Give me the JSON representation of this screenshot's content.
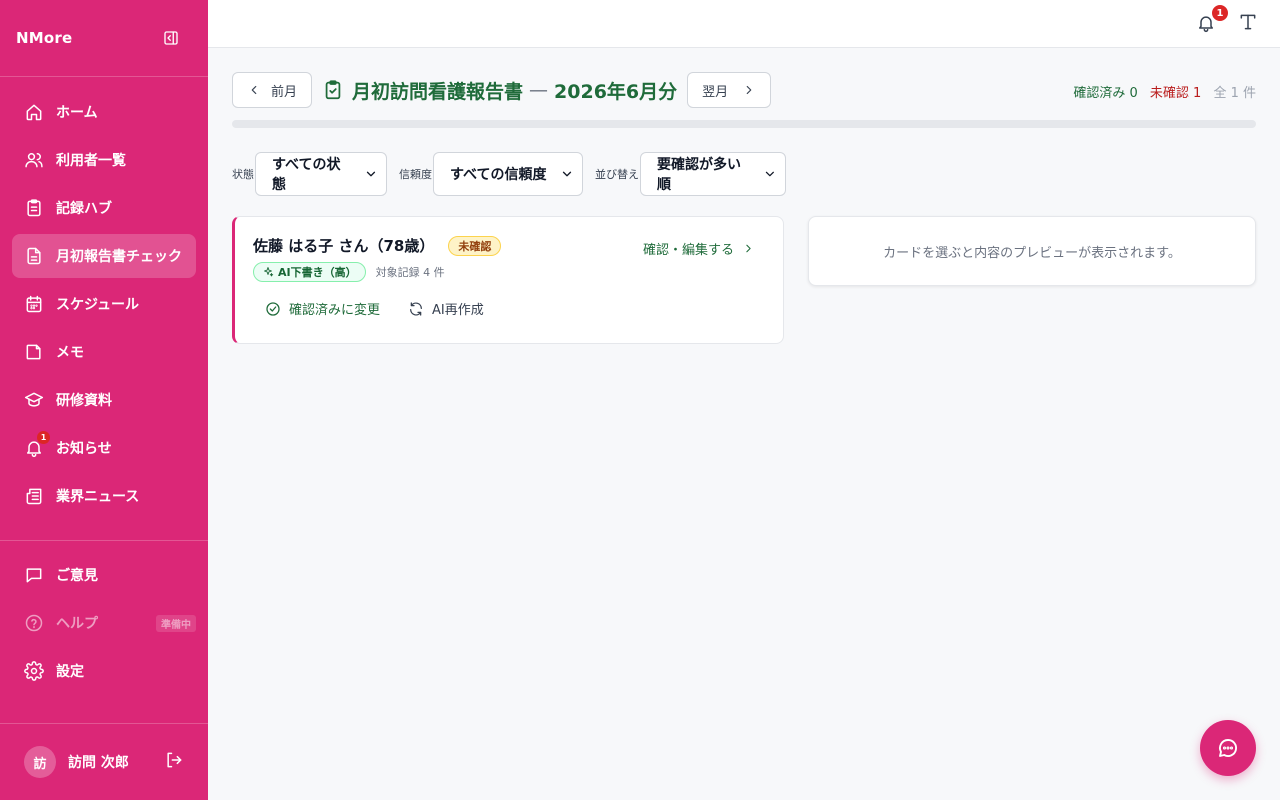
{
  "app": {
    "brand": "NMore"
  },
  "sidebar": {
    "items": [
      {
        "label": "ホーム",
        "icon": "home-icon"
      },
      {
        "label": "利用者一覧",
        "icon": "users-icon"
      },
      {
        "label": "記録ハブ",
        "icon": "clipboard-icon"
      },
      {
        "label": "月初報告書チェック",
        "icon": "document-icon",
        "active": true
      },
      {
        "label": "スケジュール",
        "icon": "calendar-icon"
      },
      {
        "label": "メモ",
        "icon": "note-icon"
      },
      {
        "label": "研修資料",
        "icon": "graduation-cap-icon"
      },
      {
        "label": "お知らせ",
        "icon": "bell-icon",
        "badge": "1"
      },
      {
        "label": "業界ニュース",
        "icon": "newspaper-icon"
      }
    ],
    "bottom": [
      {
        "label": "ご意見",
        "icon": "chat-icon"
      },
      {
        "label": "ヘルプ",
        "icon": "help-icon",
        "tag": "準備中"
      },
      {
        "label": "設定",
        "icon": "gear-icon"
      }
    ],
    "user": {
      "initial": "訪",
      "name": "訪問 次郎"
    }
  },
  "topbar": {
    "notification_badge": "1"
  },
  "header": {
    "prev_label": "前月",
    "next_label": "翌月",
    "title": "月初訪問看護報告書",
    "separator": "—",
    "period": "2026年6月分",
    "counts": {
      "confirmed": "確認済み 0",
      "unconfirmed": "未確認 1",
      "total": "全 1 件"
    },
    "progress": 0
  },
  "filters": [
    {
      "label": "状態",
      "value": "すべての状態"
    },
    {
      "label": "信頼度",
      "value": "すべての信頼度"
    },
    {
      "label": "並び替え",
      "value": "要確認が多い順"
    }
  ],
  "cards": [
    {
      "name": "佐藤 はる子 さん（78歳）",
      "status": "未確認",
      "ai_tag": "AI下書き（高）",
      "record_count": "対象記録 4 件",
      "link": "確認・編集する",
      "action_confirm": "確認済みに変更",
      "action_regen": "AI再作成"
    }
  ],
  "preview": {
    "placeholder": "カードを選ぶと内容のプレビューが表示されます。"
  },
  "colors": {
    "brand": "#db2777",
    "accent_green": "#1f6b3a",
    "danger": "#dc2626"
  }
}
